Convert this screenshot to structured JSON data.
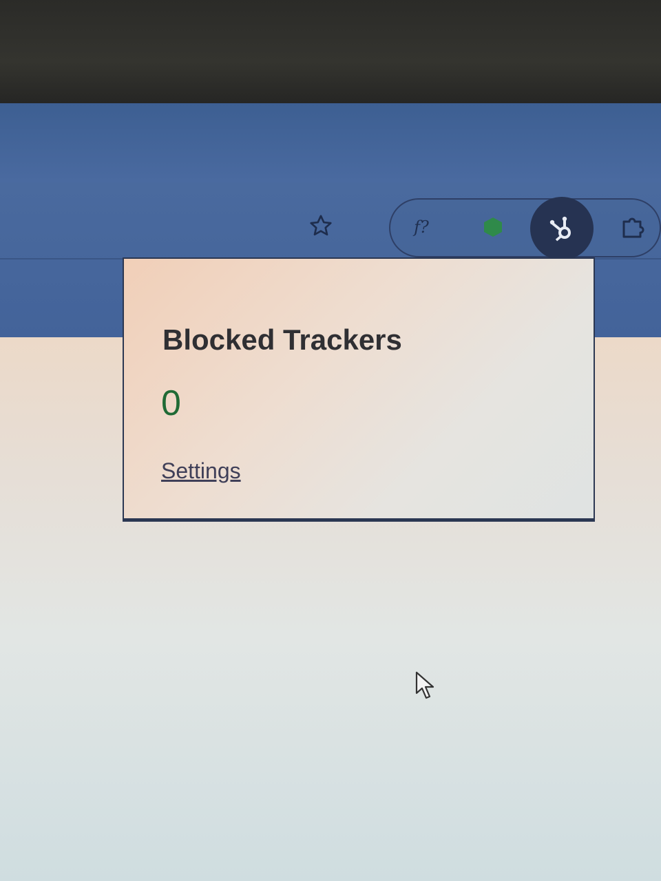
{
  "toolbar": {
    "icons": [
      "star-icon",
      "f-question-icon",
      "green-dot-icon",
      "hubspot-icon",
      "puzzle-icon"
    ],
    "extension_f_label": "f?"
  },
  "popup": {
    "title": "Blocked Trackers",
    "count": "0",
    "settings_link": "Settings"
  },
  "colors": {
    "toolbar": "#4a6a9e",
    "count_green": "#1f6a35",
    "hub_bg": "#263352"
  }
}
